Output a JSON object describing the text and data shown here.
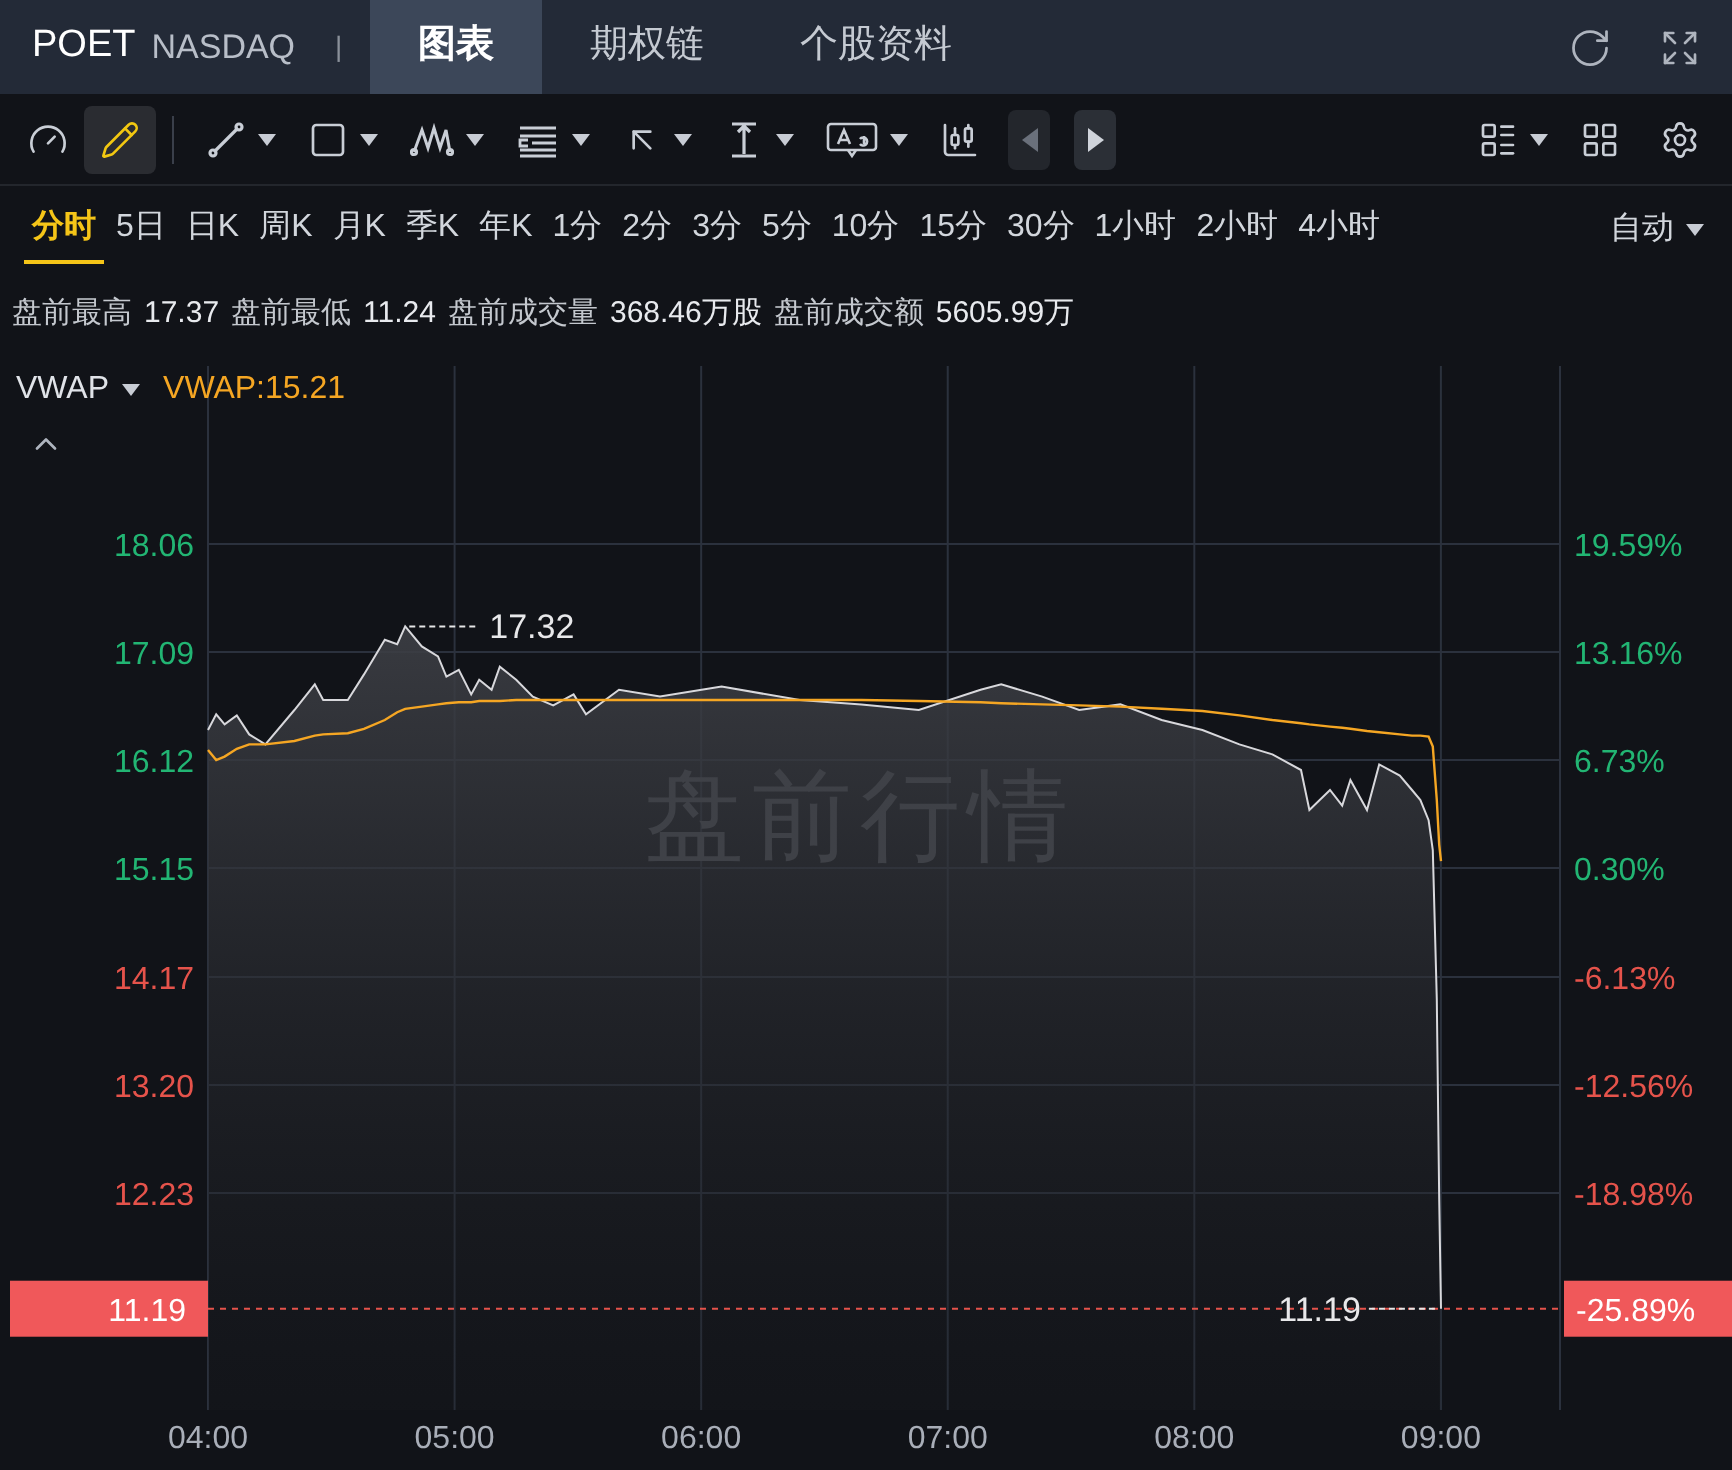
{
  "header": {
    "symbol": "POET",
    "exchange": "NASDAQ",
    "separator": "|",
    "tabs": [
      {
        "label": "图表",
        "selected": true
      },
      {
        "label": "期权链",
        "selected": false
      },
      {
        "label": "个股资料",
        "selected": false
      }
    ]
  },
  "toolbar": {
    "tools": [
      {
        "kind": "gauge",
        "active": false,
        "dropdown": false
      },
      {
        "kind": "pencil",
        "active": true,
        "dropdown": false
      },
      {
        "kind": "divider"
      },
      {
        "kind": "line",
        "active": false,
        "dropdown": true
      },
      {
        "kind": "rect",
        "active": false,
        "dropdown": true
      },
      {
        "kind": "wave",
        "active": false,
        "dropdown": true
      },
      {
        "kind": "lines",
        "active": false,
        "dropdown": true
      },
      {
        "kind": "arrow",
        "active": false,
        "dropdown": true
      },
      {
        "kind": "measure",
        "active": false,
        "dropdown": true
      },
      {
        "kind": "textbox",
        "active": false,
        "dropdown": true
      },
      {
        "kind": "candles",
        "active": false,
        "dropdown": false
      },
      {
        "kind": "prev",
        "disabled": true
      },
      {
        "kind": "next",
        "disabled": false
      },
      {
        "kind": "list",
        "active": false,
        "dropdown": true
      },
      {
        "kind": "grid",
        "active": false,
        "dropdown": false
      },
      {
        "kind": "settings",
        "active": false,
        "dropdown": false
      }
    ]
  },
  "periods": [
    {
      "label": "分时",
      "selected": true
    },
    {
      "label": "5日",
      "selected": false
    },
    {
      "label": "日K",
      "selected": false
    },
    {
      "label": "周K",
      "selected": false
    },
    {
      "label": "月K",
      "selected": false
    },
    {
      "label": "季K",
      "selected": false
    },
    {
      "label": "年K",
      "selected": false
    },
    {
      "label": "1分",
      "selected": false
    },
    {
      "label": "2分",
      "selected": false
    },
    {
      "label": "3分",
      "selected": false
    },
    {
      "label": "5分",
      "selected": false
    },
    {
      "label": "10分",
      "selected": false
    },
    {
      "label": "15分",
      "selected": false
    },
    {
      "label": "30分",
      "selected": false
    },
    {
      "label": "1小时",
      "selected": false
    },
    {
      "label": "2小时",
      "selected": false
    },
    {
      "label": "4小时",
      "selected": false
    }
  ],
  "mode": "自动",
  "stats": [
    {
      "label": "盘前最高",
      "value": "17.37"
    },
    {
      "label": "盘前最低",
      "value": "11.24"
    },
    {
      "label": "盘前成交量",
      "value": "368.46万股"
    },
    {
      "label": "盘前成交额",
      "value": "5605.99万"
    }
  ],
  "indicator": {
    "value_label": "VWAP:15.21"
  },
  "chart": {
    "watermark": "盘前行情",
    "percent_axis": [
      {
        "label": "19.59%",
        "color": "#22b573"
      },
      {
        "label": "13.16%",
        "color": "#22b573"
      },
      {
        "label": "6.73%",
        "color": "#22b573"
      },
      {
        "label": "0.30%",
        "color": "#22b573"
      },
      {
        "label": "-6.13%",
        "color": "#e5534b"
      },
      {
        "label": "-12.56%",
        "color": "#e5534b"
      },
      {
        "label": "-18.98%",
        "color": "#e5534b"
      }
    ],
    "last_price": {
      "price": "11.19",
      "percent": "-25.89%"
    },
    "chart_data": {
      "type": "area",
      "grid": true,
      "xlim": [
        4,
        9.483
      ],
      "ylim": [
        10.28,
        19.66
      ],
      "ref_lines": [
        {
          "axis": "y",
          "value": 11.19
        }
      ],
      "xticks": [
        {
          "value": 4,
          "label": "04:00"
        },
        {
          "value": 5,
          "label": "05:00"
        },
        {
          "value": 6,
          "label": "06:00"
        },
        {
          "value": 7,
          "label": "07:00"
        },
        {
          "value": 8,
          "label": "08:00"
        },
        {
          "value": 9,
          "label": "09:00"
        }
      ],
      "yticks": [
        {
          "value": 18.06,
          "label": "18.06"
        },
        {
          "value": 17.09,
          "label": "17.09"
        },
        {
          "value": 16.12,
          "label": "16.12"
        },
        {
          "value": 15.15,
          "label": "15.15"
        },
        {
          "value": 14.17,
          "label": "14.17"
        },
        {
          "value": 13.2,
          "label": "13.20"
        },
        {
          "value": 12.23,
          "label": "12.23"
        }
      ],
      "x": [
        4,
        4.033,
        4.067,
        4.117,
        4.167,
        4.233,
        4.35,
        4.433,
        4.467,
        4.567,
        4.633,
        4.717,
        4.767,
        4.8,
        4.867,
        4.933,
        4.967,
        5.017,
        5.067,
        5.1,
        5.15,
        5.183,
        5.25,
        5.317,
        5.4,
        5.483,
        5.533,
        5.667,
        5.833,
        6.083,
        6.4,
        6.65,
        6.883,
        7.133,
        7.217,
        7.383,
        7.533,
        7.7,
        7.867,
        8.033,
        8.183,
        8.317,
        8.433,
        8.467,
        8.55,
        8.6,
        8.633,
        8.7,
        8.75,
        8.833,
        8.883,
        8.917,
        8.95,
        8.967,
        8.983,
        8.993,
        9
      ],
      "series": [
        {
          "color": "#d8d8dc",
          "values": [
            16.39,
            16.53,
            16.44,
            16.52,
            16.35,
            16.26,
            16.57,
            16.8,
            16.66,
            16.66,
            16.89,
            17.2,
            17.16,
            17.32,
            17.14,
            17.05,
            16.87,
            16.93,
            16.71,
            16.84,
            16.75,
            16.96,
            16.84,
            16.69,
            16.61,
            16.71,
            16.53,
            16.75,
            16.69,
            16.78,
            16.66,
            16.62,
            16.57,
            16.75,
            16.8,
            16.69,
            16.57,
            16.62,
            16.48,
            16.39,
            16.26,
            16.17,
            16.03,
            15.67,
            15.85,
            15.71,
            15.94,
            15.67,
            16.08,
            15.98,
            15.85,
            15.76,
            15.58,
            15.31,
            13.97,
            12.17,
            11.19
          ]
        },
        {
          "name": "VWAP",
          "type": "line",
          "color": "#f5a623",
          "values": [
            16.21,
            16.12,
            16.15,
            16.22,
            16.26,
            16.26,
            16.29,
            16.34,
            16.35,
            16.36,
            16.4,
            16.48,
            16.55,
            16.58,
            16.6,
            16.62,
            16.63,
            16.64,
            16.64,
            16.65,
            16.65,
            16.65,
            16.66,
            16.66,
            16.66,
            16.66,
            16.66,
            16.66,
            16.66,
            16.66,
            16.66,
            16.66,
            16.65,
            16.64,
            16.63,
            16.62,
            16.61,
            16.6,
            16.58,
            16.56,
            16.52,
            16.48,
            16.45,
            16.44,
            16.42,
            16.41,
            16.4,
            16.38,
            16.37,
            16.35,
            16.34,
            16.34,
            16.33,
            16.24,
            15.76,
            15.36,
            15.21
          ]
        }
      ],
      "annotations": [
        {
          "x": 4.8,
          "y": 17.32,
          "text": "17.32"
        },
        {
          "x": 9,
          "y": 11.19,
          "text": "11.19"
        }
      ]
    }
  }
}
